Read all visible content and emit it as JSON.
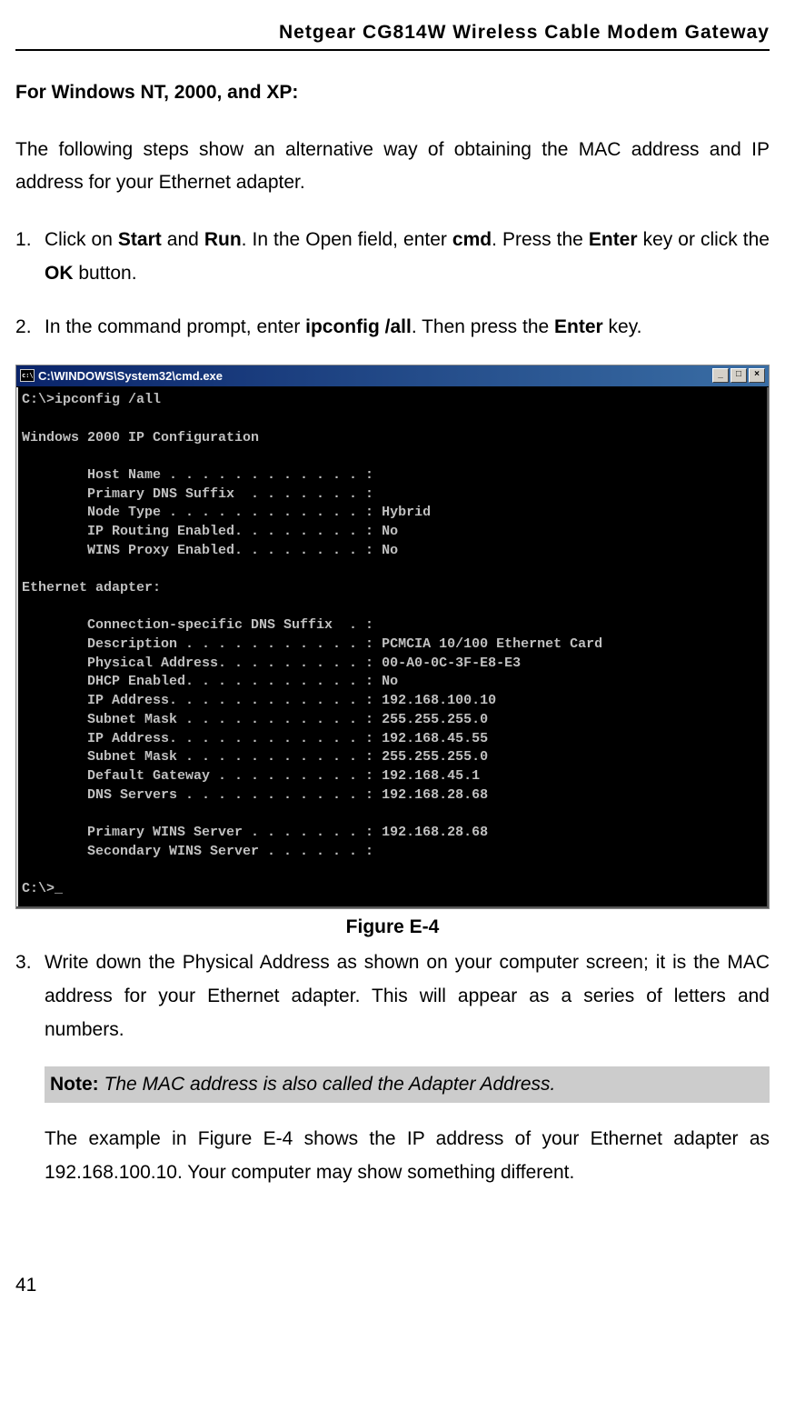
{
  "header": "Netgear CG814W Wireless Cable Modem Gateway",
  "section_heading": "For Windows NT, 2000, and XP:",
  "intro": "The following steps show an alternative way of obtaining the MAC address and IP address for your Ethernet adapter.",
  "steps": {
    "s1": {
      "pre1": "Click on ",
      "b1": "Start",
      "mid1": " and ",
      "b2": "Run",
      "mid2": ". In the Open field, enter ",
      "b3": "cmd",
      "mid3": ". Press the ",
      "b4": "Enter",
      "mid4": " key or click the ",
      "b5": "OK",
      "post": " button."
    },
    "s2": {
      "pre": "In the command prompt, enter ",
      "b1": "ipconfig /all",
      "mid": ". Then press the ",
      "b2": "Enter",
      "post": " key."
    },
    "s3": "Write down the Physical Address as shown on your computer screen; it is the MAC address for your Ethernet adapter. This will appear as a series of letters and numbers."
  },
  "cmd": {
    "title": "C:\\WINDOWS\\System32\\cmd.exe",
    "lines": "C:\\>ipconfig /all\n\nWindows 2000 IP Configuration\n\n        Host Name . . . . . . . . . . . . :\n        Primary DNS Suffix  . . . . . . . :\n        Node Type . . . . . . . . . . . . : Hybrid\n        IP Routing Enabled. . . . . . . . : No\n        WINS Proxy Enabled. . . . . . . . : No\n\nEthernet adapter:\n\n        Connection-specific DNS Suffix  . :\n        Description . . . . . . . . . . . : PCMCIA 10/100 Ethernet Card\n        Physical Address. . . . . . . . . : 00-A0-0C-3F-E8-E3\n        DHCP Enabled. . . . . . . . . . . : No\n        IP Address. . . . . . . . . . . . : 192.168.100.10\n        Subnet Mask . . . . . . . . . . . : 255.255.255.0\n        IP Address. . . . . . . . . . . . : 192.168.45.55\n        Subnet Mask . . . . . . . . . . . : 255.255.255.0\n        Default Gateway . . . . . . . . . : 192.168.45.1\n        DNS Servers . . . . . . . . . . . : 192.168.28.68\n\n        Primary WINS Server . . . . . . . : 192.168.28.68\n        Secondary WINS Server . . . . . . :\n\nC:\\>_"
  },
  "figure_caption": "Figure E-4",
  "note": {
    "label": "Note:",
    "text": " The MAC address is also called the Adapter Address."
  },
  "after_note": "The example in Figure E-4 shows the IP address of your Ethernet adapter as 192.168.100.10. Your computer may show something different.",
  "page_number": "41"
}
